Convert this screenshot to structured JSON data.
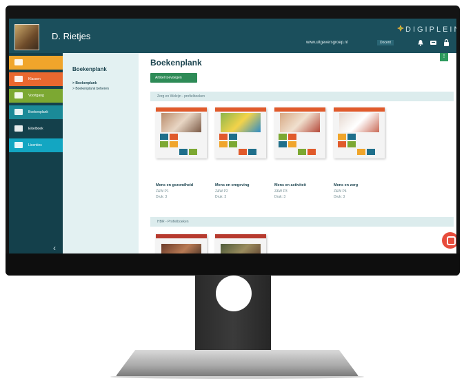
{
  "app": {
    "user_name": "D. Rietjes",
    "brand": "DIGIPLEIN",
    "website": "www.uitgeversgroep.nl",
    "role_badge": "Docent"
  },
  "icons": {
    "notifications": "bell-icon",
    "news": "megaphone-icon",
    "lock": "lock-icon"
  },
  "sidebar": {
    "items": [
      {
        "label": "",
        "color": "#f0a52b"
      },
      {
        "label": "Klassen",
        "color": "#e9682f"
      },
      {
        "label": "Voortgang",
        "color": "#7ca832"
      },
      {
        "label": "Boekenplank",
        "color": "#1b8a98"
      },
      {
        "label": "Eikelboek",
        "color": "#14404b"
      },
      {
        "label": "Licenties",
        "color": "#13a6c2"
      }
    ],
    "collapse_glyph": "‹"
  },
  "subnav": {
    "title": "Boekenplank",
    "links": [
      "Boekenplank",
      "Boekenplank beheren"
    ]
  },
  "main": {
    "title": "Boekenplank",
    "add_button": "Artikel toevoegen",
    "sections": [
      {
        "label": "Zorg en Welzijn - profielboeken",
        "books": [
          {
            "title": "Mens en gezondheid",
            "code": "Z&W P1",
            "edition": "Druk: 3"
          },
          {
            "title": "Mens en omgeving",
            "code": "Z&W P2",
            "edition": "Druk: 3"
          },
          {
            "title": "Mens en activiteit",
            "code": "Z&W P3",
            "edition": "Druk: 3"
          },
          {
            "title": "Mens en zorg",
            "code": "Z&W P4",
            "edition": "Druk: 3"
          }
        ]
      },
      {
        "label": "HBR - Profielboeken"
      }
    ]
  },
  "colors": {
    "topbar": "#1b4f5c",
    "accent_green": "#2e8b57",
    "chat": "#e74c3c"
  }
}
